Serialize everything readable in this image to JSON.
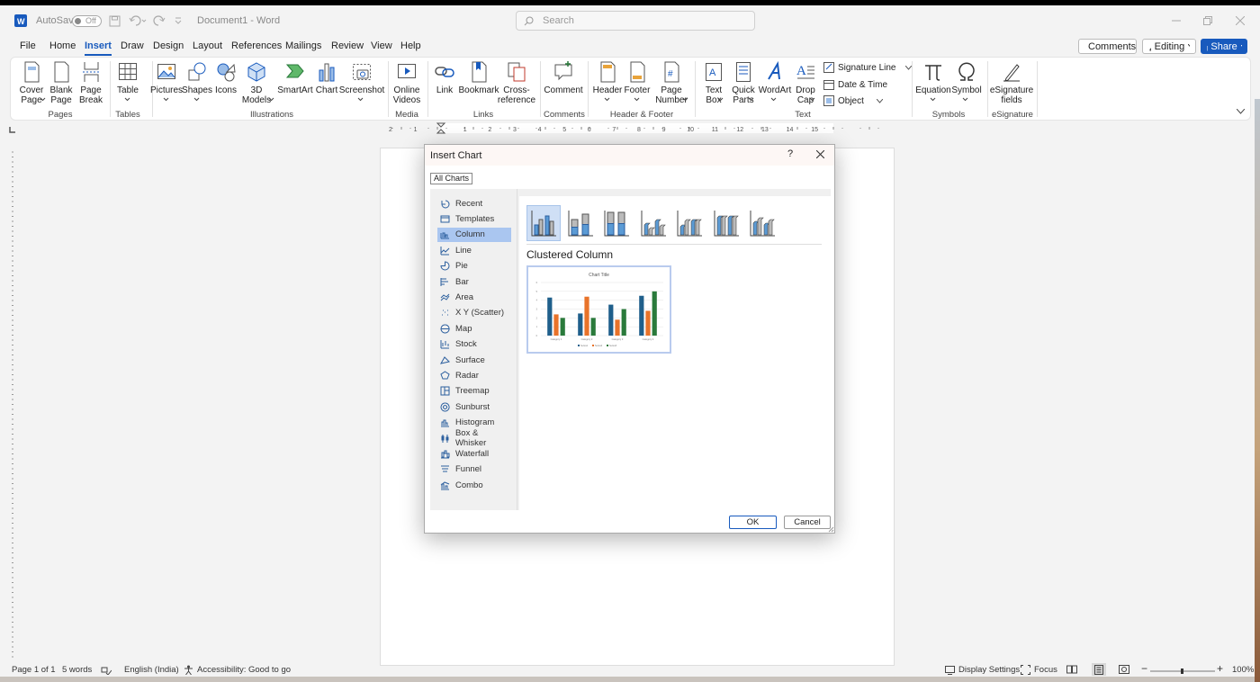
{
  "titlebar": {
    "autosave_label": "AutoSave",
    "autosave_state": "Off",
    "doc_title": "Document1  -  Word",
    "search_placeholder": "Search"
  },
  "menu": [
    "File",
    "Home",
    "Insert",
    "Draw",
    "Design",
    "Layout",
    "References",
    "Mailings",
    "Review",
    "View",
    "Help"
  ],
  "menu_active": "Insert",
  "top_buttons": {
    "comments": "Comments",
    "editing": "Editing",
    "share": "Share"
  },
  "ribbon": {
    "buttons": {
      "cover": [
        "Cover",
        "Page"
      ],
      "blank": [
        "Blank",
        "Page"
      ],
      "break": [
        "Page",
        "Break"
      ],
      "table": [
        "Table",
        ""
      ],
      "pictures": [
        "Pictures",
        ""
      ],
      "shapes": [
        "Shapes",
        ""
      ],
      "icons": [
        "Icons",
        ""
      ],
      "models": [
        "3D",
        "Models"
      ],
      "smartart": [
        "SmartArt",
        ""
      ],
      "chart": [
        "Chart",
        ""
      ],
      "screenshot": [
        "Screenshot",
        ""
      ],
      "videos": [
        "Online",
        "Videos"
      ],
      "link": [
        "Link",
        ""
      ],
      "bookmark": [
        "Bookmark",
        ""
      ],
      "crossref": [
        "Cross-",
        "reference"
      ],
      "comment": [
        "Comment",
        ""
      ],
      "header": [
        "Header",
        ""
      ],
      "footer": [
        "Footer",
        ""
      ],
      "pagenum": [
        "Page",
        "Number"
      ],
      "textbox": [
        "Text",
        "Box"
      ],
      "quickparts": [
        "Quick",
        "Parts"
      ],
      "wordart": [
        "WordArt",
        ""
      ],
      "dropcap": [
        "Drop",
        "Cap"
      ],
      "equation": [
        "Equation",
        ""
      ],
      "symbol": [
        "Symbol",
        ""
      ],
      "esig": [
        "eSignature",
        "fields"
      ]
    },
    "text_small": {
      "sigline": "Signature Line",
      "datetime": "Date & Time",
      "object": "Object"
    },
    "groups": {
      "pages": "Pages",
      "tables": "Tables",
      "illustrations": "Illustrations",
      "media": "Media",
      "links": "Links",
      "comments": "Comments",
      "headerfooter": "Header & Footer",
      "text": "Text",
      "symbols": "Symbols",
      "esignature": "eSignature"
    }
  },
  "dialog": {
    "title": "Insert Chart",
    "help": "?",
    "tab": "All Charts",
    "categories": [
      "Recent",
      "Templates",
      "Column",
      "Line",
      "Pie",
      "Bar",
      "Area",
      "X Y (Scatter)",
      "Map",
      "Stock",
      "Surface",
      "Radar",
      "Treemap",
      "Sunburst",
      "Histogram",
      "Box & Whisker",
      "Waterfall",
      "Funnel",
      "Combo"
    ],
    "selected_category": "Column",
    "selected_type": "Clustered Column",
    "ok": "OK",
    "cancel": "Cancel"
  },
  "chart_data": {
    "type": "bar",
    "title": "Chart Title",
    "categories": [
      "Category 1",
      "Category 2",
      "Category 3",
      "Category 4"
    ],
    "series": [
      {
        "name": "Series1",
        "values": [
          4.3,
          2.5,
          3.5,
          4.5
        ],
        "color": "#1f5f8b"
      },
      {
        "name": "Series2",
        "values": [
          2.4,
          4.4,
          1.8,
          2.8
        ],
        "color": "#e8732a"
      },
      {
        "name": "Series3",
        "values": [
          2,
          2,
          3,
          5
        ],
        "color": "#2a7a3b"
      }
    ],
    "ylim": [
      0,
      6
    ],
    "legend": "bottom",
    "grid": true
  },
  "status": {
    "page": "Page 1 of 1",
    "words": "5 words",
    "language": "English (India)",
    "accessibility": "Accessibility: Good to go",
    "display": "Display Settings",
    "focus": "Focus",
    "zoom": "100%"
  },
  "colors": {
    "accent": "#185abd",
    "selection": "#aac6f0"
  }
}
